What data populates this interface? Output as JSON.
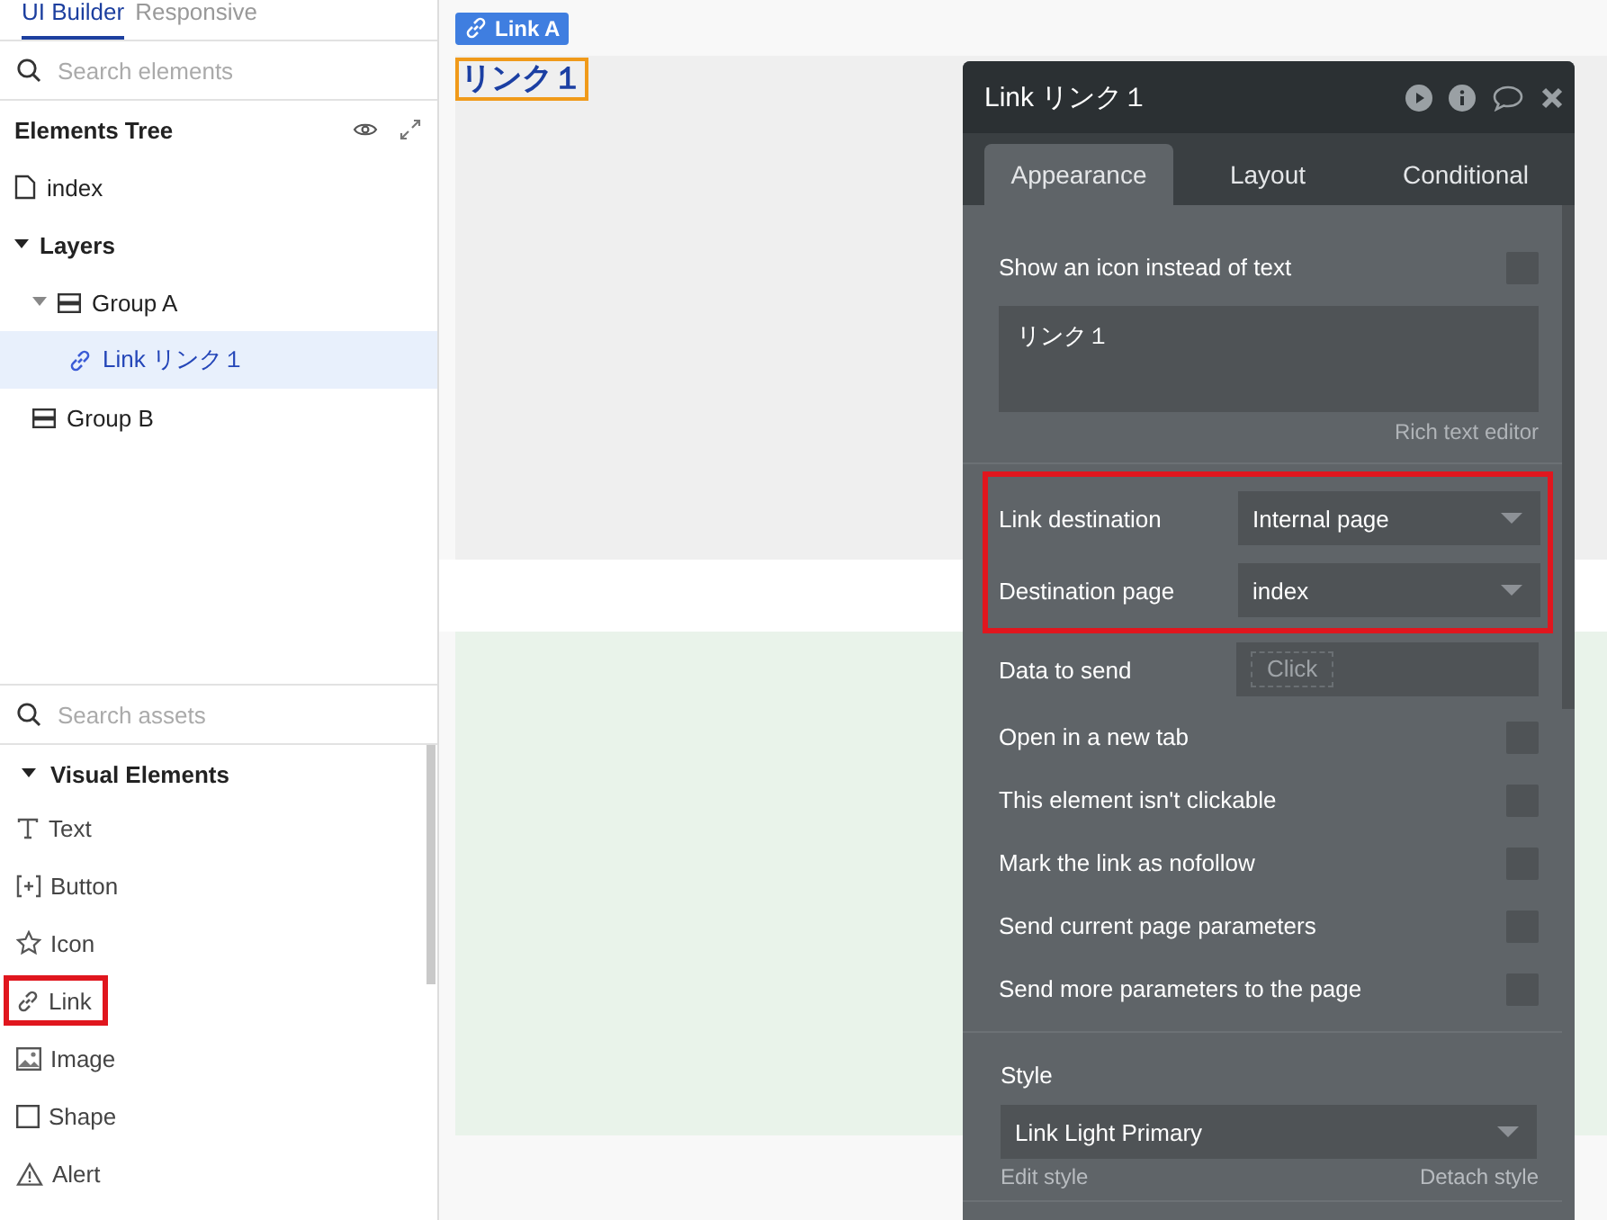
{
  "sidebar": {
    "tabs": [
      {
        "label": "UI Builder",
        "selected": true
      },
      {
        "label": "Responsive",
        "selected": false
      }
    ],
    "search": {
      "placeholder": "Search elements"
    },
    "tree_title": "Elements Tree",
    "tree": [
      {
        "label": "index",
        "kind": "page",
        "selected": false
      },
      {
        "label": "Layers",
        "kind": "section",
        "expanded": true,
        "selected": false,
        "children": [
          {
            "label": "Group A",
            "kind": "group",
            "expanded": true,
            "selected": false,
            "children": [
              {
                "label": "Link リンク１",
                "kind": "link",
                "selected": true
              }
            ]
          },
          {
            "label": "Group B",
            "kind": "group",
            "selected": false
          }
        ]
      }
    ],
    "assets_search": {
      "placeholder": "Search assets"
    },
    "assets_section": {
      "label": "Visual Elements",
      "expanded": true
    },
    "assets": [
      {
        "label": "Text",
        "kind": "text",
        "highlighted": false
      },
      {
        "label": "Button",
        "kind": "button",
        "highlighted": false
      },
      {
        "label": "Icon",
        "kind": "icon",
        "highlighted": false
      },
      {
        "label": "Link",
        "kind": "link",
        "highlighted": true
      },
      {
        "label": "Image",
        "kind": "image",
        "highlighted": false
      },
      {
        "label": "Shape",
        "kind": "shape",
        "highlighted": false
      },
      {
        "label": "Alert",
        "kind": "alert",
        "highlighted": false
      }
    ]
  },
  "canvas": {
    "element_tag": "Link A",
    "link_text": "リンク１"
  },
  "panel": {
    "title": "Link リンク１",
    "tabs": [
      {
        "label": "Appearance",
        "selected": true
      },
      {
        "label": "Layout",
        "selected": false
      },
      {
        "label": "Conditional",
        "selected": false
      }
    ],
    "top_rows": [
      {
        "kind": "checkbox",
        "label": "Show an icon instead of text",
        "checked": false
      },
      {
        "kind": "textarea",
        "value": "リンク１",
        "hint": "Rich text editor"
      }
    ],
    "highlighted_rows": {
      "highlighted": true,
      "rows": [
        {
          "kind": "dropdown",
          "label": "Link destination",
          "value": "Internal page"
        },
        {
          "kind": "dropdown",
          "label": "Destination page",
          "value": "index"
        }
      ]
    },
    "rows": [
      {
        "kind": "field",
        "label": "Data to send",
        "placeholder": "Click"
      },
      {
        "kind": "checkbox",
        "label": "Open in a new tab",
        "checked": false
      },
      {
        "kind": "checkbox",
        "label": "This element isn't clickable",
        "checked": false
      },
      {
        "kind": "checkbox",
        "label": "Mark the link as nofollow",
        "checked": false
      },
      {
        "kind": "checkbox",
        "label": "Send current page parameters",
        "checked": false
      },
      {
        "kind": "checkbox",
        "label": "Send more parameters to the page",
        "checked": false
      }
    ],
    "style": {
      "label": "Style",
      "value": "Link Light Primary",
      "edit": "Edit style",
      "detach": "Detach style"
    }
  }
}
